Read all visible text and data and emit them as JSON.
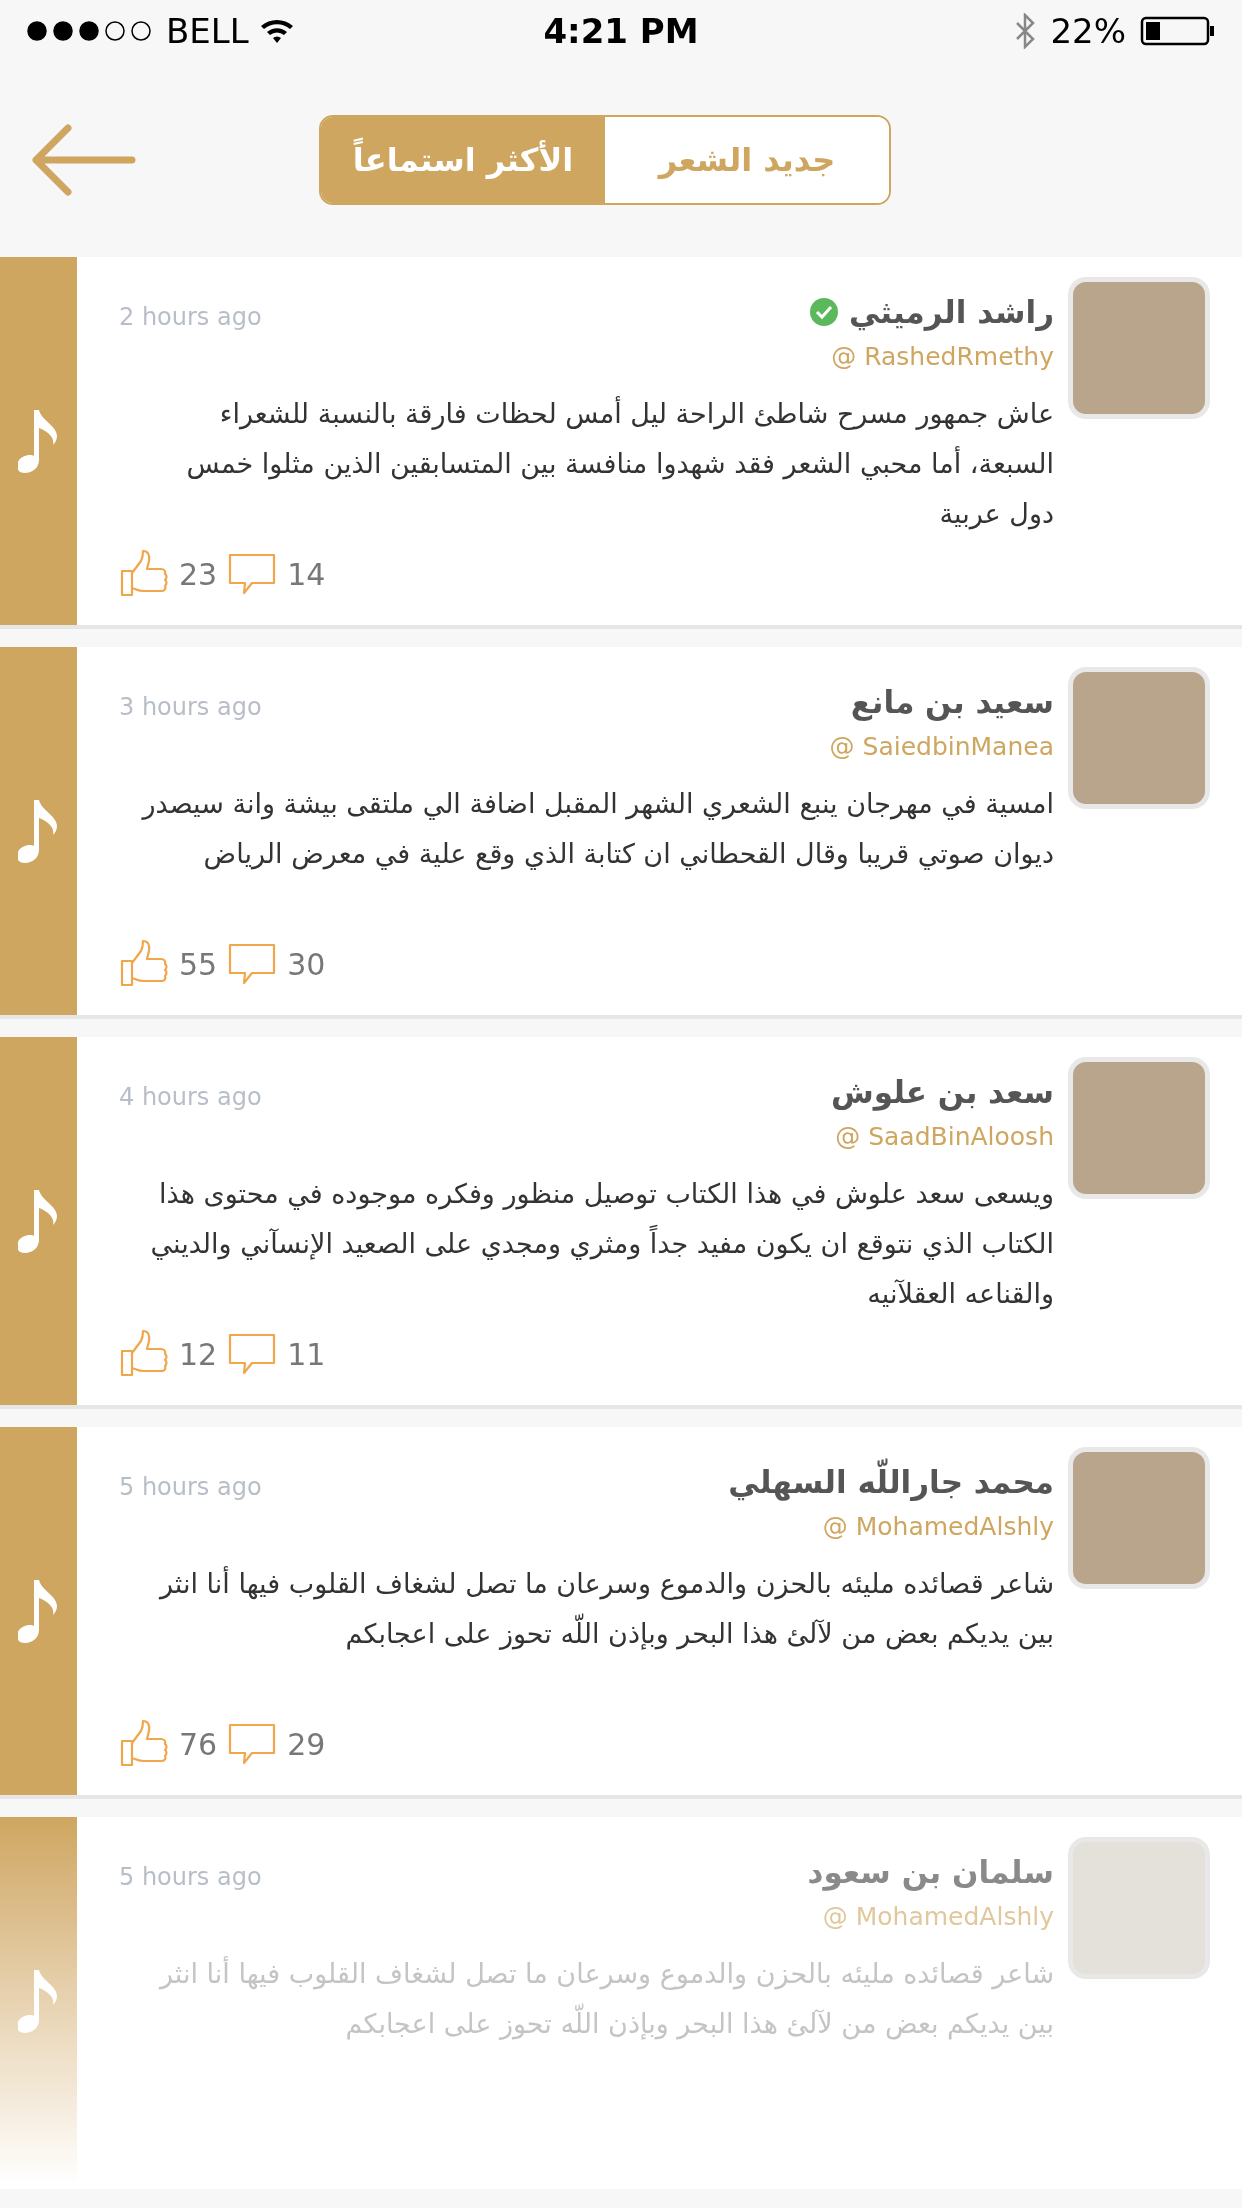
{
  "status_bar": {
    "carrier": "BELL",
    "time": "4:21 PM",
    "battery": "22%"
  },
  "tabs": [
    {
      "label": "جديد الشعر",
      "selected": false
    },
    {
      "label": "الأكثر استماعاً",
      "selected": true
    }
  ],
  "posts": [
    {
      "name": "راشد الرميثي",
      "verified": true,
      "handle": "@ RashedRmethy",
      "time": "2 hours ago",
      "text": "عاش جمهور مسرح شاطئ الراحة ليل أمس لحظات فارقة بالنسبة للشعراء السبعة، أما محبي الشعر فقد شهدوا منافسة بين المتسابقين الذين مثلوا خمس دول عربية",
      "likes": "23",
      "comments": "14",
      "faded": false
    },
    {
      "name": "سعيد بن مانع",
      "verified": false,
      "handle": "@ SaiedbinManea",
      "time": "3 hours ago",
      "text": "امسية في مهرجان ينبع الشعري الشهر المقبل اضافة الي ملتقى بيشة وانة سيصدر ديوان صوتي قريبا وقال القحطاني ان كتابة الذي وقع علية في معرض الرياض",
      "likes": "55",
      "comments": "30",
      "faded": false
    },
    {
      "name": "سعد بن علوش",
      "verified": false,
      "handle": "@ SaadBinAloosh",
      "time": "4 hours ago",
      "text": "ويسعى سعد علوش في هذا الكتاب توصيل منظور وفكره موجوده في محتوى هذا الكتاب الذي نتوقع ان يكون مفيد جداً ومثري ومجدي على الصعيد الإنسآني والديني والقناعه العقلآنيه",
      "likes": "12",
      "comments": "11",
      "faded": false
    },
    {
      "name": "محمد جاراللّه السهلي",
      "verified": false,
      "handle": "@ MohamedAlshly",
      "time": "5 hours ago",
      "text": "شاعر قصائده مليئه بالحزن والدموع وسرعان ما تصل لشغاف القلوب فيها أنا انثر بين يديكم بعض من لآلئ هذا البحر وبإذن اللّه تحوز على اعجابكم",
      "likes": "76",
      "comments": "29",
      "faded": false
    },
    {
      "name": "سلمان بن سعود",
      "verified": false,
      "handle": "@ MohamedAlshly",
      "time": "5 hours ago",
      "text": "شاعر قصائده مليئه بالحزن والدموع وسرعان ما تصل لشغاف القلوب فيها أنا انثر بين يديكم بعض من لآلئ هذا البحر وبإذن اللّه تحوز على اعجابكم",
      "faded": true
    }
  ]
}
